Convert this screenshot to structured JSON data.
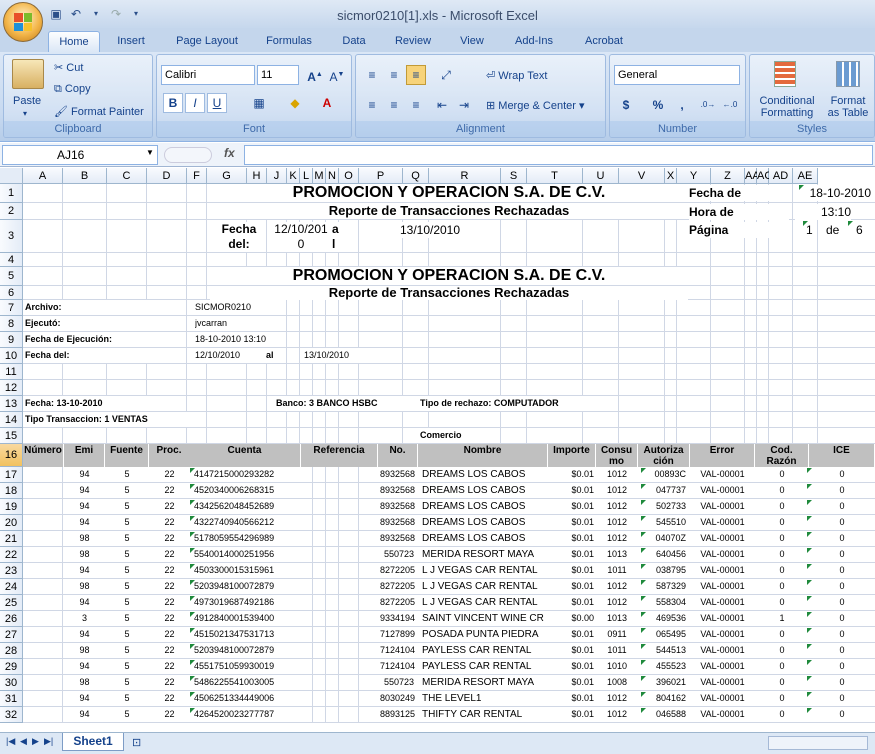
{
  "window": {
    "title": "sicmor0210[1].xls - Microsoft Excel"
  },
  "tabs": [
    "Home",
    "Insert",
    "Page Layout",
    "Formulas",
    "Data",
    "Review",
    "View",
    "Add-Ins",
    "Acrobat"
  ],
  "clipboard": {
    "paste": "Paste",
    "cut": "Cut",
    "copy": "Copy",
    "format_painter": "Format Painter",
    "label": "Clipboard"
  },
  "font": {
    "name": "Calibri",
    "size": "11",
    "label": "Font"
  },
  "alignment": {
    "wrap": "Wrap Text",
    "merge": "Merge & Center",
    "label": "Alignment"
  },
  "number": {
    "format": "General",
    "label": "Number",
    "currency": "$",
    "percent": "%",
    "comma": ","
  },
  "styles": {
    "conditional": "Conditional",
    "conditional2": "Formatting",
    "format_as": "Format",
    "format_as2": "as Table",
    "label": "Styles"
  },
  "namebox": "AJ16",
  "fx": "fx",
  "columns": [
    "A",
    "B",
    "C",
    "D",
    "F",
    "G",
    "H",
    "J",
    "K",
    "L",
    "M",
    "N",
    "O",
    "P",
    "Q",
    "R",
    "S",
    "T",
    "U",
    "V",
    "X",
    "Y",
    "Z",
    "AA",
    "AC",
    "AD",
    "AE"
  ],
  "report": {
    "company": "PROMOCION Y OPERACION S.A. DE C.V.",
    "subtitle": "Reporte de Transacciones Rechazadas",
    "fecha_del": "Fecha del:",
    "fecha_from": "12/10/2010",
    "a": "a l",
    "fecha_to": "13/10/2010",
    "fecha_de_label": "Fecha de",
    "fecha_de": "18-10-2010",
    "hora_label": "Hora de",
    "hora": "13:10",
    "pagina_label": "Página",
    "pagina": "1",
    "de": "de",
    "pages": "6",
    "archivo_label": "Archivo:",
    "archivo": "SICMOR0210",
    "ejecuto_label": "Ejecutó:",
    "ejecuto": "jvcarran",
    "fecha_ejec_label": "Fecha de Ejecución:",
    "fecha_ejec": "18-10-2010 13:10",
    "fecha_del_label": "Fecha del:",
    "fecha_del_val": "12/10/2010",
    "al": "al",
    "fecha_al_val": "13/10/2010",
    "fecha_line": "Fecha:  13-10-2010",
    "banco": "Banco: 3   BANCO HSBC",
    "tipo_rechazo": "Tipo de rechazo: COMPUTADOR",
    "tipo_trans": "Tipo Transaccion:  1 VENTAS",
    "comercio": "Comercio"
  },
  "table": {
    "headers": [
      "Núm­ero",
      "Emi",
      "Fuente",
      "Proc.",
      "Cuenta",
      "Referencia",
      "No.",
      "Nombre",
      "Importe",
      "Consu mo",
      "Autoriza ción",
      "Error",
      "Cod. Razón",
      "ICE"
    ],
    "rows": [
      [
        "94",
        "5",
        "22",
        "4147215000293282",
        "8932568",
        "DREAMS LOS CABOS",
        "$0.01",
        "1012",
        "00893C",
        "VAL-00001",
        "0",
        "0"
      ],
      [
        "94",
        "5",
        "22",
        "4520340006268315",
        "8932568",
        "DREAMS LOS CABOS",
        "$0.01",
        "1012",
        "047737",
        "VAL-00001",
        "0",
        "0"
      ],
      [
        "94",
        "5",
        "22",
        "4342562048452689",
        "8932568",
        "DREAMS LOS CABOS",
        "$0.01",
        "1012",
        "502733",
        "VAL-00001",
        "0",
        "0"
      ],
      [
        "94",
        "5",
        "22",
        "4322740940566212",
        "8932568",
        "DREAMS LOS CABOS",
        "$0.01",
        "1012",
        "545510",
        "VAL-00001",
        "0",
        "0"
      ],
      [
        "98",
        "5",
        "22",
        "5178059554296989",
        "8932568",
        "DREAMS LOS CABOS",
        "$0.01",
        "1012",
        "04070Z",
        "VAL-00001",
        "0",
        "0"
      ],
      [
        "98",
        "5",
        "22",
        "5540014000251956",
        "550723",
        "MERIDA RESORT MAYA",
        "$0.01",
        "1013",
        "640456",
        "VAL-00001",
        "0",
        "0"
      ],
      [
        "94",
        "5",
        "22",
        "4503300015315961",
        "8272205",
        "L J VEGAS CAR RENTAL",
        "$0.01",
        "1011",
        "038795",
        "VAL-00001",
        "0",
        "0"
      ],
      [
        "98",
        "5",
        "22",
        "5203948100072879",
        "8272205",
        "L J VEGAS CAR RENTAL",
        "$0.01",
        "1012",
        "587329",
        "VAL-00001",
        "0",
        "0"
      ],
      [
        "94",
        "5",
        "22",
        "4973019687492186",
        "8272205",
        "L J VEGAS CAR RENTAL",
        "$0.01",
        "1012",
        "558304",
        "VAL-00001",
        "0",
        "0"
      ],
      [
        "3",
        "5",
        "22",
        "4912840001539400",
        "9334194",
        "SAINT VINCENT WINE CR",
        "$0.00",
        "1013",
        "469536",
        "VAL-00001",
        "1",
        "0"
      ],
      [
        "94",
        "5",
        "22",
        "4515021347531713",
        "7127899",
        "POSADA PUNTA PIEDRA",
        "$0.01",
        "0911",
        "065495",
        "VAL-00001",
        "0",
        "0"
      ],
      [
        "98",
        "5",
        "22",
        "5203948100072879",
        "7124104",
        "PAYLESS CAR RENTAL",
        "$0.01",
        "1011",
        "544513",
        "VAL-00001",
        "0",
        "0"
      ],
      [
        "94",
        "5",
        "22",
        "4551751059930019",
        "7124104",
        "PAYLESS CAR RENTAL",
        "$0.01",
        "1010",
        "455523",
        "VAL-00001",
        "0",
        "0"
      ],
      [
        "98",
        "5",
        "22",
        "5486225541003005",
        "550723",
        "MERIDA RESORT MAYA",
        "$0.01",
        "1008",
        "396021",
        "VAL-00001",
        "0",
        "0"
      ],
      [
        "94",
        "5",
        "22",
        "4506251334449006",
        "8030249",
        "THE LEVEL1",
        "$0.01",
        "1012",
        "804162",
        "VAL-00001",
        "0",
        "0"
      ],
      [
        "94",
        "5",
        "22",
        "4264520023277787",
        "8893125",
        "THIFTY CAR RENTAL",
        "$0.01",
        "1012",
        "046588",
        "VAL-00001",
        "0",
        "0"
      ]
    ]
  },
  "row_numbers": [
    "1",
    "2",
    "3",
    "4",
    "5",
    "6",
    "7",
    "8",
    "9",
    "10",
    "11",
    "12",
    "13",
    "14",
    "15",
    "16",
    "17",
    "18",
    "19",
    "20",
    "21",
    "22",
    "23",
    "24",
    "25",
    "26",
    "27",
    "28",
    "29",
    "30",
    "31",
    "32"
  ],
  "sheet": "Sheet1"
}
